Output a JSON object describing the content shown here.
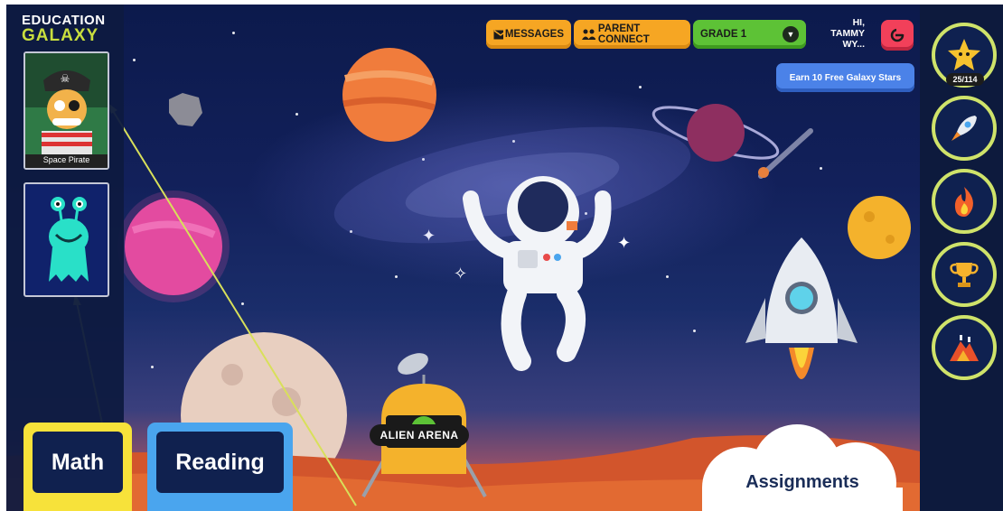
{
  "brand": {
    "line1": "EDUCATION",
    "line2": "GALAXY"
  },
  "avatars": [
    {
      "caption": "Space Pirate",
      "icon": "pirate-avatar"
    },
    {
      "caption": "",
      "icon": "alien-avatar"
    }
  ],
  "topbar": {
    "messages_label": "MESSAGES",
    "parent_connect_label": "PARENT CONNECT",
    "grade_label": "GRADE 1",
    "greeting": "HI,",
    "username": "TAMMY WY...",
    "earn_label": "Earn 10 Free Galaxy Stars"
  },
  "rightnav": {
    "stars_progress": "25/114",
    "items": [
      {
        "icon": "star-icon"
      },
      {
        "icon": "rocket-icon"
      },
      {
        "icon": "fire-icon"
      },
      {
        "icon": "trophy-icon"
      },
      {
        "icon": "volcano-icon"
      }
    ]
  },
  "scene": {
    "lander_label": "ALIEN ARENA"
  },
  "subjects": [
    {
      "label": "Math"
    },
    {
      "label": "Reading"
    }
  ],
  "assignments_label": "Assignments",
  "colors": {
    "accent_orange": "#f6a623",
    "accent_green": "#5dc236",
    "accent_blue": "#4b82e8",
    "accent_red": "#f2405a",
    "brand_green": "#c9de3e",
    "ring_color": "#cfe36a",
    "annotation_arrow": "#d8e05a"
  }
}
